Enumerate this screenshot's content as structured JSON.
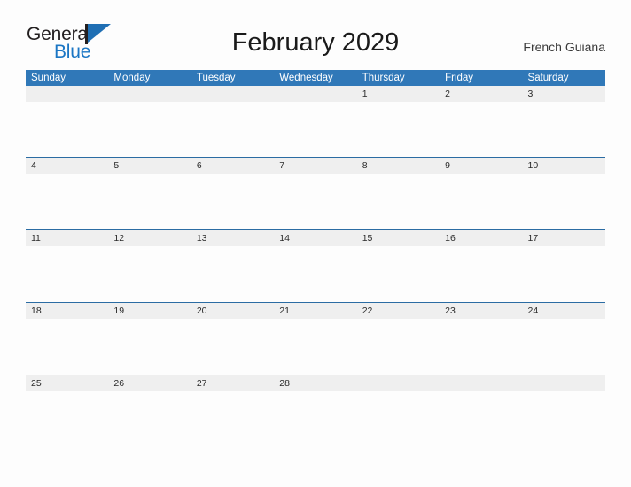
{
  "brand": {
    "name_part1": "General",
    "name_part2": "Blue",
    "mark": "flag-triangle"
  },
  "header": {
    "title": "February 2029",
    "region": "French Guiana"
  },
  "colors": {
    "header_blue": "#3078b8",
    "row_rule_blue": "#2b6ca3",
    "date_band_gray": "#efefef",
    "logo_blue": "#1b76c4",
    "page_background": "#fdfdfd"
  },
  "calendar": {
    "month": "February",
    "year": "2029",
    "weekday_headers": [
      "Sunday",
      "Monday",
      "Tuesday",
      "Wednesday",
      "Thursday",
      "Friday",
      "Saturday"
    ],
    "weeks": [
      [
        "",
        "",
        "",
        "",
        "1",
        "2",
        "3"
      ],
      [
        "4",
        "5",
        "6",
        "7",
        "8",
        "9",
        "10"
      ],
      [
        "11",
        "12",
        "13",
        "14",
        "15",
        "16",
        "17"
      ],
      [
        "18",
        "19",
        "20",
        "21",
        "22",
        "23",
        "24"
      ],
      [
        "25",
        "26",
        "27",
        "28",
        "",
        "",
        ""
      ]
    ]
  }
}
